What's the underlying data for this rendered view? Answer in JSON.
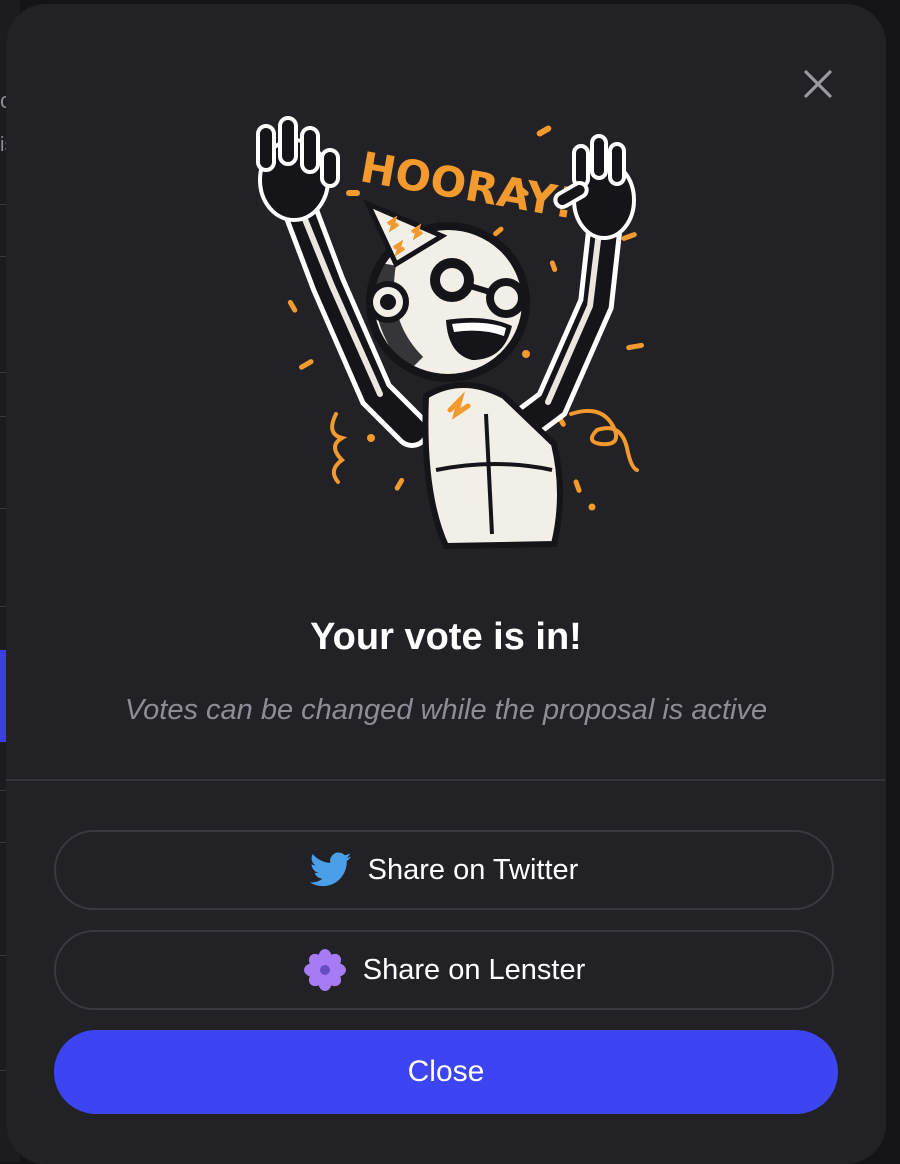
{
  "background": {
    "fragments": [
      "c",
      "is"
    ]
  },
  "modal": {
    "title": "Your vote is in!",
    "subtitle": "Votes can be changed while the proposal is active",
    "illustration_text": "HOORAY!!",
    "share_twitter_label": "Share on Twitter",
    "share_lenster_label": "Share on Lenster",
    "close_label": "Close",
    "icons": {
      "close": "close-icon",
      "twitter": "twitter-icon",
      "lenster": "lenster-icon"
    }
  },
  "colors": {
    "modal_bg": "#222126",
    "primary": "#3d44f2",
    "twitter": "#4a9fe8",
    "lenster": "#a77bf3",
    "accent_orange": "#f29a2e",
    "subtitle": "#8e8d96"
  }
}
